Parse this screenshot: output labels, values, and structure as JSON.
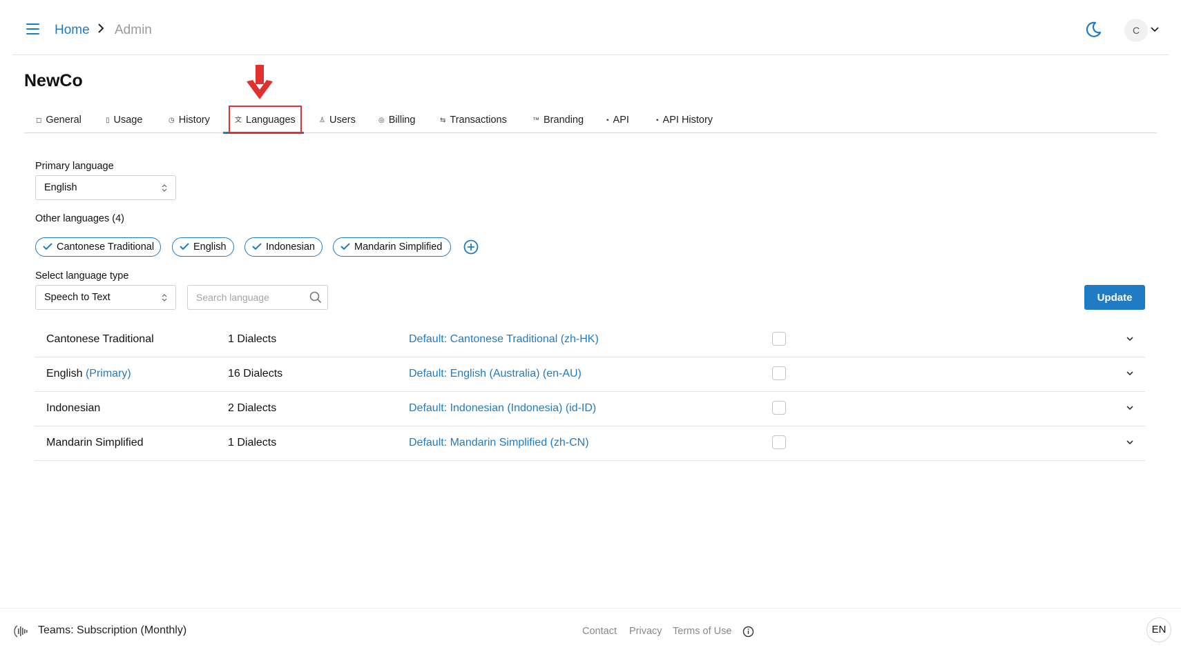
{
  "breadcrumb": {
    "home": "Home",
    "current": "Admin"
  },
  "user": {
    "initial": "C"
  },
  "page": {
    "title": "NewCo"
  },
  "tabs": [
    {
      "label": "General",
      "icon": "square-icon"
    },
    {
      "label": "Usage",
      "icon": "bucket-icon"
    },
    {
      "label": "History",
      "icon": "history-icon"
    },
    {
      "label": "Languages",
      "icon": "translate-icon",
      "active": true
    },
    {
      "label": "Users",
      "icon": "user-icon"
    },
    {
      "label": "Billing",
      "icon": "coins-icon"
    },
    {
      "label": "Transactions",
      "icon": "arrows-icon"
    },
    {
      "label": "Branding",
      "icon": "tm-icon"
    },
    {
      "label": "API",
      "icon": "api-icon"
    },
    {
      "label": "API History",
      "icon": "api-icon"
    }
  ],
  "form": {
    "primary_label": "Primary language",
    "primary_value": "English",
    "other_label": "Other languages (4)",
    "chips": [
      "Cantonese Traditional",
      "English",
      "Indonesian",
      "Mandarin Simplified"
    ],
    "type_label": "Select language type",
    "type_value": "Speech to Text",
    "search_placeholder": "Search language",
    "update_label": "Update"
  },
  "languages": [
    {
      "name": "Cantonese Traditional",
      "primary": "",
      "dialects": "1 Dialects",
      "default": "Default: Cantonese Traditional (zh-HK)",
      "checked": false
    },
    {
      "name": "English",
      "primary": "(Primary)",
      "dialects": "16 Dialects",
      "default": "Default: English (Australia) (en-AU)",
      "checked": false
    },
    {
      "name": "Indonesian",
      "primary": "",
      "dialects": "2 Dialects",
      "default": "Default: Indonesian (Indonesia) (id-ID)",
      "checked": false
    },
    {
      "name": "Mandarin Simplified",
      "primary": "",
      "dialects": "1 Dialects",
      "default": "Default: Mandarin Simplified (zh-CN)",
      "checked": false
    }
  ],
  "footer": {
    "plan": "Teams: Subscription (Monthly)",
    "links": [
      "Contact",
      "Privacy",
      "Terms of Use"
    ],
    "lang": "EN"
  },
  "colors": {
    "accent": "#1e7bc4",
    "annotation": "#e03030"
  }
}
